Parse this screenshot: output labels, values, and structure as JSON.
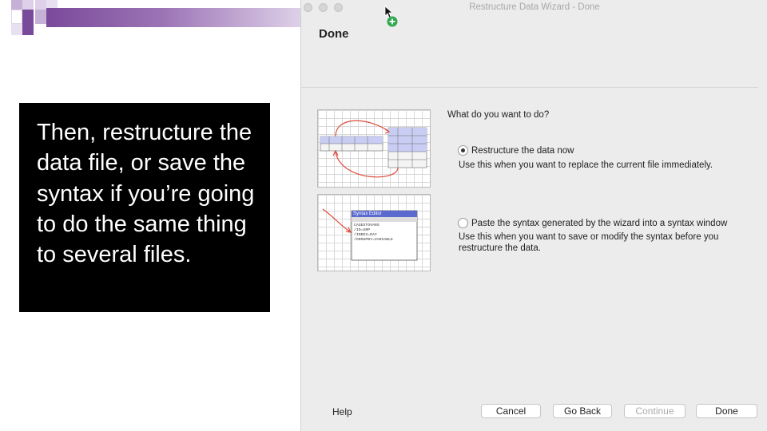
{
  "slide": {
    "callout_text": "Then, restructure the data file, or save the syntax if you’re going to do the same thing to several files.",
    "colors": {
      "accent": "#7a4a9a",
      "accent_light": "#c6b1d6",
      "callout_bg": "#000000"
    }
  },
  "dialog": {
    "window_title": "Restructure Data Wizard - Done",
    "step_title": "Done",
    "question": "What do you want to do?",
    "options": [
      {
        "label": "Restructure the data now",
        "description": "Use this when you want to replace the current file immediately.",
        "selected": true
      },
      {
        "label": "Paste the syntax generated by the wizard into a syntax window",
        "description_line1": "Use this when you want to save or modify the syntax before you",
        "description_line2": "restructure the data.",
        "selected": false
      }
    ],
    "thumb_syntax": {
      "title": "Syntax Editor",
      "lines": [
        "CASESTOVARS",
        "/ID=GRP",
        "/INDEX=DAY",
        "/GROUPBY=VARIABLE"
      ]
    },
    "buttons": {
      "help": "Help",
      "cancel": "Cancel",
      "go_back": "Go Back",
      "continue": "Continue",
      "done": "Done"
    }
  }
}
